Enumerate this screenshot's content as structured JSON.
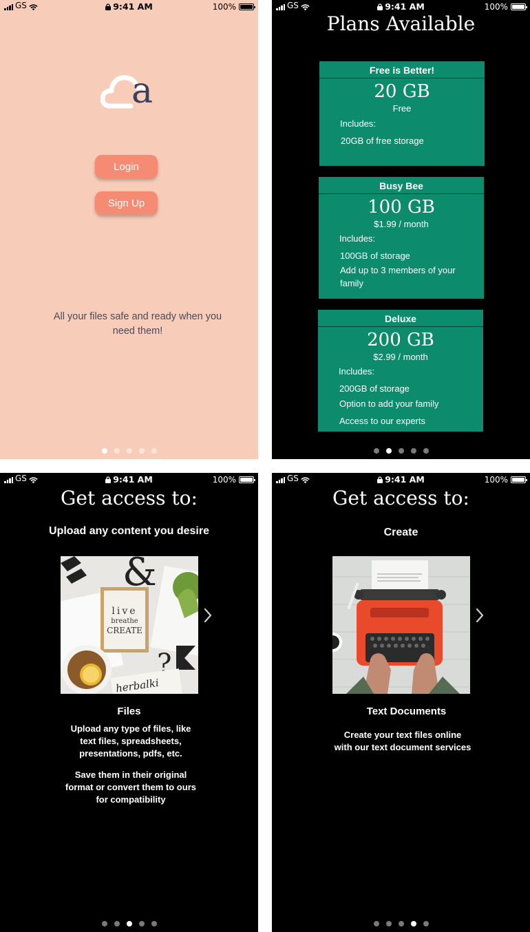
{
  "status_bar": {
    "carrier": "GS",
    "time": "9:41 AM",
    "battery": "100%"
  },
  "screens": [
    {
      "logo_letter": "a",
      "login_label": "Login",
      "signup_label": "Sign Up",
      "tagline": "All your files safe and ready when you need them!",
      "active_page": 1
    },
    {
      "title": "Plans Available",
      "active_page": 2,
      "plans": [
        {
          "name": "Free is Better!",
          "size": "20 GB",
          "price": "Free",
          "includes": "Includes:",
          "features": [
            "20GB of free storage"
          ]
        },
        {
          "name": "Busy Bee",
          "size": "100 GB",
          "price": "$1.99 / month",
          "includes": "Includes:",
          "features": [
            "100GB of  storage",
            "Add up to 3 members of your family"
          ]
        },
        {
          "name": "Deluxe",
          "size": "200 GB",
          "price": "$2.99 / month",
          "includes": "Includes:",
          "features": [
            "200GB of  storage",
            "Option to add your family",
            "Access to our experts"
          ]
        }
      ]
    },
    {
      "title": "Get access to:",
      "subtitle": "Upload any content you desire",
      "item_title": "Files",
      "description_1": "Upload any type of files, like text files, spreadsheets, presentations, pdfs, etc.",
      "description_2": "Save them in their original format or convert them to ours for compatibility",
      "active_page": 3,
      "photo_text": {
        "ampersand": "&",
        "frame_line1": "live",
        "frame_line2": "breathe",
        "frame_line3": "CREATE",
        "brand": "herbalki",
        "question": "?"
      }
    },
    {
      "title": "Get access to:",
      "subtitle": "Create",
      "item_title": "Text Documents",
      "description_1": "Create your text files online with our text document services",
      "active_page": 4
    }
  ],
  "colors": {
    "peach_bg": "#f7cdb9",
    "button": "#f58b73",
    "plan_green": "#0c8c6c",
    "logo_dark": "#3b3f5c"
  }
}
